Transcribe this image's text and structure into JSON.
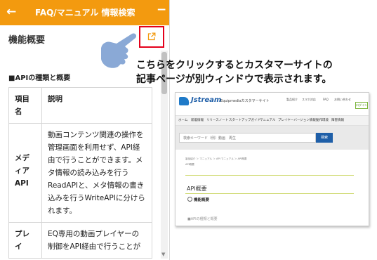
{
  "panel": {
    "title": "FAQ/マニュアル 情報検索",
    "back_icon": "←",
    "minimize_icon": "−",
    "section_title": "機能概要",
    "subheading": "■APIの種類と概要",
    "table": {
      "headers": [
        "項目名",
        "説明"
      ],
      "rows": [
        [
          "メディアAPI",
          "動画コンテンツ関連の操作を管理画面を利用せず、API経由で行うことができます。メタ情報の読み込みを行うReadAPIと、メタ情報の書き込みを行うWriteAPIに分けられます。"
        ],
        [
          "プレイ",
          "EQ専用の動画プレイヤーの制御をAPI経由で行うことが"
        ]
      ]
    },
    "accent_color": "#f39a0f"
  },
  "caption": {
    "line1": "こちらをクリックするとカスタマーサイトの",
    "line2": "記事ページが別ウィンドウで表示されます。"
  },
  "site": {
    "logo": "Jstream",
    "logo_sub": "Equipmediaカスタマーサイト",
    "util": [
      "製品紹介",
      "スマホ対応",
      "FAQ",
      "お問い合わせ"
    ],
    "login": "ログイン",
    "nav": [
      "ホーム",
      "新着情報",
      "リリースノート",
      "スタートアップガイド",
      "マニュアル",
      "プレイヤーバージョン情報",
      "動作環境",
      "障害情報"
    ],
    "search_placeholder": "検索キーワード（例）動画　再生",
    "search_button": "検索",
    "breadcrumb": "製品紹介 ＞ マニュアル ＞ API マニュアル ＞ API概要",
    "breadcrumb2": "API概要",
    "page_heading": "API概要",
    "section_heading": "機能概要",
    "faded_text": "■APIの種類と概要",
    "brand_color": "#1f5fa8"
  }
}
